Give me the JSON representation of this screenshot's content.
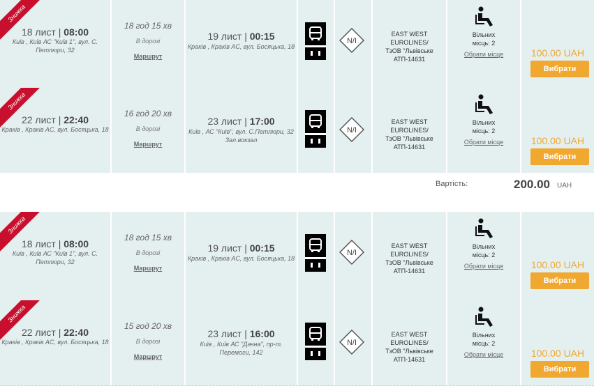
{
  "labels": {
    "discount": "Знижка",
    "on_road": "В дорозі",
    "route": "Маршрут",
    "free_seats_1": "Вільних",
    "choose_seat": "Обрати місце",
    "select_button": "Вибрати",
    "ni": "N/I"
  },
  "trips": [
    {
      "dep_date": "18 лист",
      "dep_time": "08:00",
      "dep_addr_1": "Київ , Київ АС \"Київ 1\", вул. С.",
      "dep_addr_2": "Петлюри, 32",
      "duration": "18 год 15 хв",
      "arr_date": "19 лист",
      "arr_time": "00:15",
      "arr_addr_1": "Краків , Краків AC, вул. Босяцька, 18",
      "arr_addr_2": "",
      "carrier_1": "EAST WEST EUROLINES/",
      "carrier_2": "ТзОВ \"Львівське",
      "carrier_3": "АТП-14631",
      "seats": "місць: 2",
      "price": "100.00 UAH"
    },
    {
      "dep_date": "22 лист",
      "dep_time": "22:40",
      "dep_addr_1": "Краків , Краків AC, вул. Босяцька, 18",
      "dep_addr_2": "",
      "duration": "16 год 20 хв",
      "arr_date": "23 лист",
      "arr_time": "17:00",
      "arr_addr_1": "Київ , АС \"Київ\", вул. С.Петлюри, 32",
      "arr_addr_2": "Зал.вокзал",
      "carrier_1": "EAST WEST EUROLINES/",
      "carrier_2": "ТзОВ \"Львівське",
      "carrier_3": "АТП-14631",
      "seats": "місць: 2",
      "price": "100.00 UAH"
    },
    {
      "dep_date": "18 лист",
      "dep_time": "08:00",
      "dep_addr_1": "Київ , Київ АС \"Київ 1\", вул. С.",
      "dep_addr_2": "Петлюри, 32",
      "duration": "18 год 15 хв",
      "arr_date": "19 лист",
      "arr_time": "00:15",
      "arr_addr_1": "Краків , Краків AC, вул. Босяцька, 18",
      "arr_addr_2": "",
      "carrier_1": "EAST WEST EUROLINES/",
      "carrier_2": "ТзОВ \"Львівське",
      "carrier_3": "АТП-14631",
      "seats": "місць: 2",
      "price": "100.00 UAH"
    },
    {
      "dep_date": "22 лист",
      "dep_time": "22:40",
      "dep_addr_1": "Краків , Краків AC, вул. Босяцька, 18",
      "dep_addr_2": "",
      "duration": "15 год 20 хв",
      "arr_date": "23 лист",
      "arr_time": "16:00",
      "arr_addr_1": "Київ , Київ АС \"Дачна\", пр-т.",
      "arr_addr_2": "Перемоги, 142",
      "carrier_1": "EAST WEST EUROLINES/",
      "carrier_2": "ТзОВ \"Львівське",
      "carrier_3": "АТП-14631",
      "seats": "місць: 2",
      "price": "100.00 UAH"
    }
  ],
  "total": {
    "label": "Вартість:",
    "value": "200.00",
    "currency": "UAH"
  },
  "colors": {
    "row_bg": "#e4eff0",
    "accent": "#f0a830",
    "discount_ribbon": "#c8102e"
  },
  "icons": [
    "bus-icon",
    "ni-badge-icon",
    "seat-icon"
  ]
}
